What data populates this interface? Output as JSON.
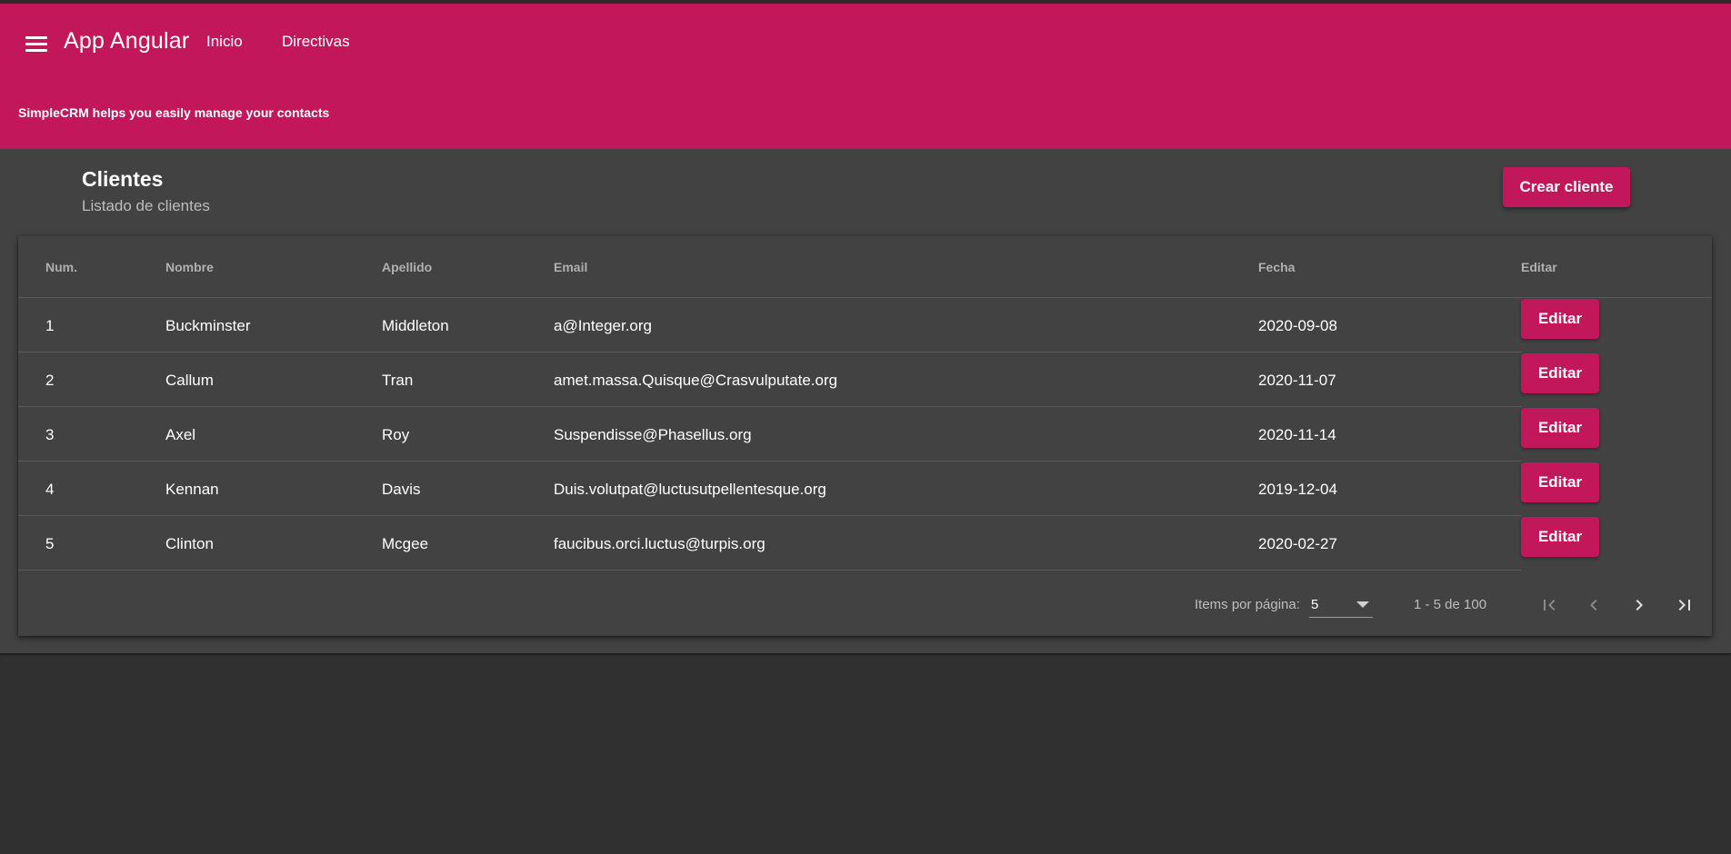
{
  "header": {
    "app_title": "App Angular",
    "nav": [
      "Inicio",
      "Directivas"
    ],
    "tagline": "SimpleCRM helps you easily manage your contacts",
    "menu_icon": "menu-icon",
    "color": "#c2185b"
  },
  "page": {
    "title": "Clientes",
    "subtitle": "Listado de clientes",
    "create_button": "Crear cliente"
  },
  "table": {
    "columns": [
      "Num.",
      "Nombre",
      "Apellido",
      "Email",
      "Fecha",
      "Editar"
    ],
    "rows": [
      {
        "num": "1",
        "nombre": "Buckminster",
        "apellido": "Middleton",
        "email": "a@Integer.org",
        "fecha": "2020-09-08",
        "editar": "Editar"
      },
      {
        "num": "2",
        "nombre": "Callum",
        "apellido": "Tran",
        "email": "amet.massa.Quisque@Crasvulputate.org",
        "fecha": "2020-11-07",
        "editar": "Editar"
      },
      {
        "num": "3",
        "nombre": "Axel",
        "apellido": "Roy",
        "email": "Suspendisse@Phasellus.org",
        "fecha": "2020-11-14",
        "editar": "Editar"
      },
      {
        "num": "4",
        "nombre": "Kennan",
        "apellido": "Davis",
        "email": "Duis.volutpat@luctusutpellentesque.org",
        "fecha": "2019-12-04",
        "editar": "Editar"
      },
      {
        "num": "5",
        "nombre": "Clinton",
        "apellido": "Mcgee",
        "email": "faucibus.orci.luctus@turpis.org",
        "fecha": "2020-02-27",
        "editar": "Editar"
      }
    ]
  },
  "paginator": {
    "items_label": "Items por página:",
    "page_size": "5",
    "range": "1 - 5 de 100",
    "icons": [
      "first-page-icon",
      "previous-page-icon",
      "next-page-icon",
      "last-page-icon"
    ]
  },
  "colors": {
    "accent": "#c2185b",
    "background": "#303030",
    "card": "#424242"
  }
}
